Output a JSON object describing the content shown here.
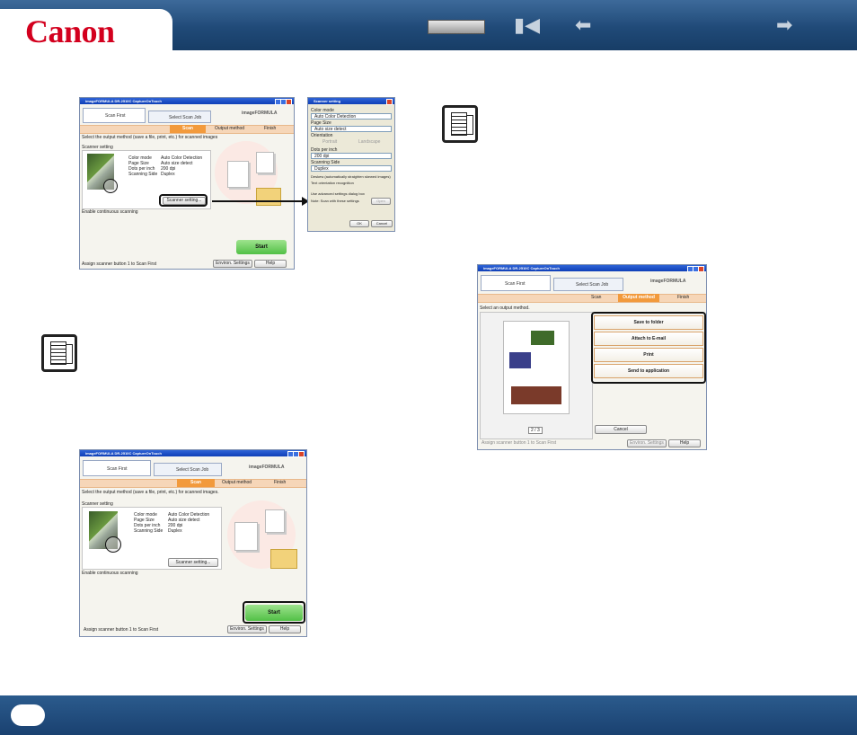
{
  "header": {
    "brand": "Canon",
    "nav_icons": [
      "first-page-icon",
      "back-arrow-icon",
      "forward-arrow-icon"
    ]
  },
  "colors": {
    "header_blue": "#204a78",
    "brand_red": "#d3001e",
    "step_orange": "#f29a3c",
    "start_green": "#52c046"
  },
  "shot1": {
    "title": "imageFORMULA DR-2510C CaptureOnTouch",
    "tab_scan_first": "Scan First",
    "tab_select_job": "Select Scan Job",
    "brand": "imageFORMULA",
    "steps": [
      "Scan",
      "Output method",
      "Finish"
    ],
    "instruction": "Select the output method (save a file, print, etc.) for scanned images",
    "section": "Scanner setting",
    "settings": [
      {
        "k": "Color mode",
        "v": "Auto Color Detection"
      },
      {
        "k": "Page Size",
        "v": "Auto size detect"
      },
      {
        "k": "Dots per inch",
        "v": "200 dpi"
      },
      {
        "k": "Scanning Side",
        "v": "Duplex"
      }
    ],
    "scanner_setting_button": "Scanner setting...",
    "continuous": "Enable continuous scanning",
    "start": "Start",
    "footer_check": "Assign scanner button 1 to Scan First",
    "env_settings": "Environ. Settings",
    "help": "Help"
  },
  "dialog": {
    "title": "Scanner setting",
    "color_mode_label": "Color mode",
    "color_mode_value": "Auto Color Detection",
    "page_size_label": "Page Size",
    "page_size_value": "Auto size detect",
    "orientation_label": "Orientation",
    "portrait": "Portrait",
    "landscape": "Landscape",
    "dpi_label": "Dots per inch",
    "dpi_value": "200 dpi",
    "side_label": "Scanning Side",
    "side_value": "Duplex",
    "deskew": "Deskew (automatically straighten skewed images)",
    "text_orientation": "Text orientation recognition",
    "use_advanced": "Use advanced settings dialog box",
    "note": "Note: Scan with these settings",
    "open": "Open",
    "ok": "OK",
    "cancel": "Cancel"
  },
  "shot2": {
    "title": "imageFORMULA DR-2510C CaptureOnTouch",
    "tab_scan_first": "Scan First",
    "tab_select_job": "Select Scan Job",
    "brand": "imageFORMULA",
    "steps": [
      "Scan",
      "Output method",
      "Finish"
    ],
    "instruction": "Select an output method.",
    "outputs": [
      "Save to folder",
      "Attach to E-mail",
      "Print",
      "Send to application"
    ],
    "page_counter": "2 / 3",
    "cancel": "Cancel",
    "footer_check": "Assign scanner button 1 to Scan First",
    "env_settings": "Environ. Settings",
    "help": "Help"
  },
  "shot3": {
    "title": "imageFORMULA DR-2510C CaptureOnTouch",
    "tab_scan_first": "Scan First",
    "tab_select_job": "Select Scan Job",
    "brand": "imageFORMULA",
    "steps": [
      "Scan",
      "Output method",
      "Finish"
    ],
    "instruction": "Select the output method (save a file, print, etc.) for scanned images.",
    "section": "Scanner setting",
    "settings": [
      {
        "k": "Color mode",
        "v": "Auto Color Detection"
      },
      {
        "k": "Page Size",
        "v": "Auto size detect"
      },
      {
        "k": "Dots per inch",
        "v": "200 dpi"
      },
      {
        "k": "Scanning Side",
        "v": "Duplex"
      }
    ],
    "scanner_setting_button": "Scanner setting...",
    "continuous": "Enable continuous scanning",
    "start": "Start",
    "footer_check": "Assign scanner button 1 to Scan First",
    "env_settings": "Environ. Settings",
    "help": "Help"
  },
  "note_icons": [
    "note-icon",
    "note-icon"
  ]
}
